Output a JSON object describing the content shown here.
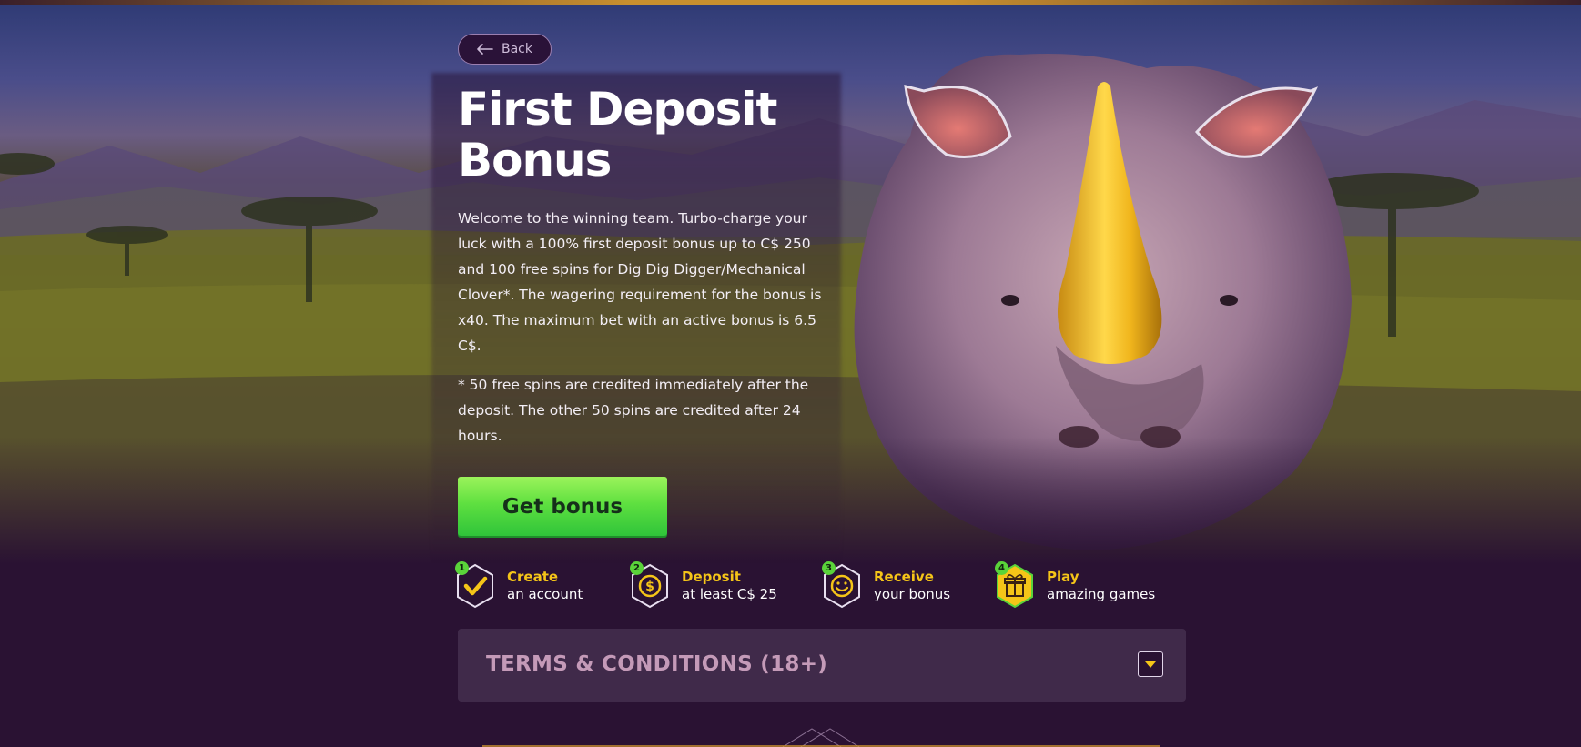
{
  "nav": {
    "back_label": "Back"
  },
  "hero": {
    "title": "First Deposit Bonus",
    "description": "Welcome to the winning team. Turbo-charge your luck with a 100% first deposit bonus up to C$ 250 and 100 free spins for Dig Dig Digger/Mechanical Clover*. The wagering requirement for the bonus is x40. The maximum bet with an active bonus is 6.5 C$.",
    "note": "* 50 free spins are credited immediately after the deposit. The other 50 spins are credited after 24 hours.",
    "cta_label": "Get bonus"
  },
  "steps": [
    {
      "number": "1",
      "title": "Create",
      "subtitle": "an account",
      "icon": "checkmark-icon"
    },
    {
      "number": "2",
      "title": "Deposit",
      "subtitle": "at least C$ 25",
      "icon": "coin-icon"
    },
    {
      "number": "3",
      "title": "Receive",
      "subtitle": "your bonus",
      "icon": "smiley-icon"
    },
    {
      "number": "4",
      "title": "Play",
      "subtitle": "amazing games",
      "icon": "gift-icon"
    }
  ],
  "terms": {
    "title": "TERMS & CONDITIONS (18+)",
    "toggle_icon": "chevron-down-icon"
  },
  "colors": {
    "background": "#2a1233",
    "accent_yellow": "#f5c518",
    "cta_green": "#4fd83f",
    "terms_panel": "#402a4a"
  }
}
